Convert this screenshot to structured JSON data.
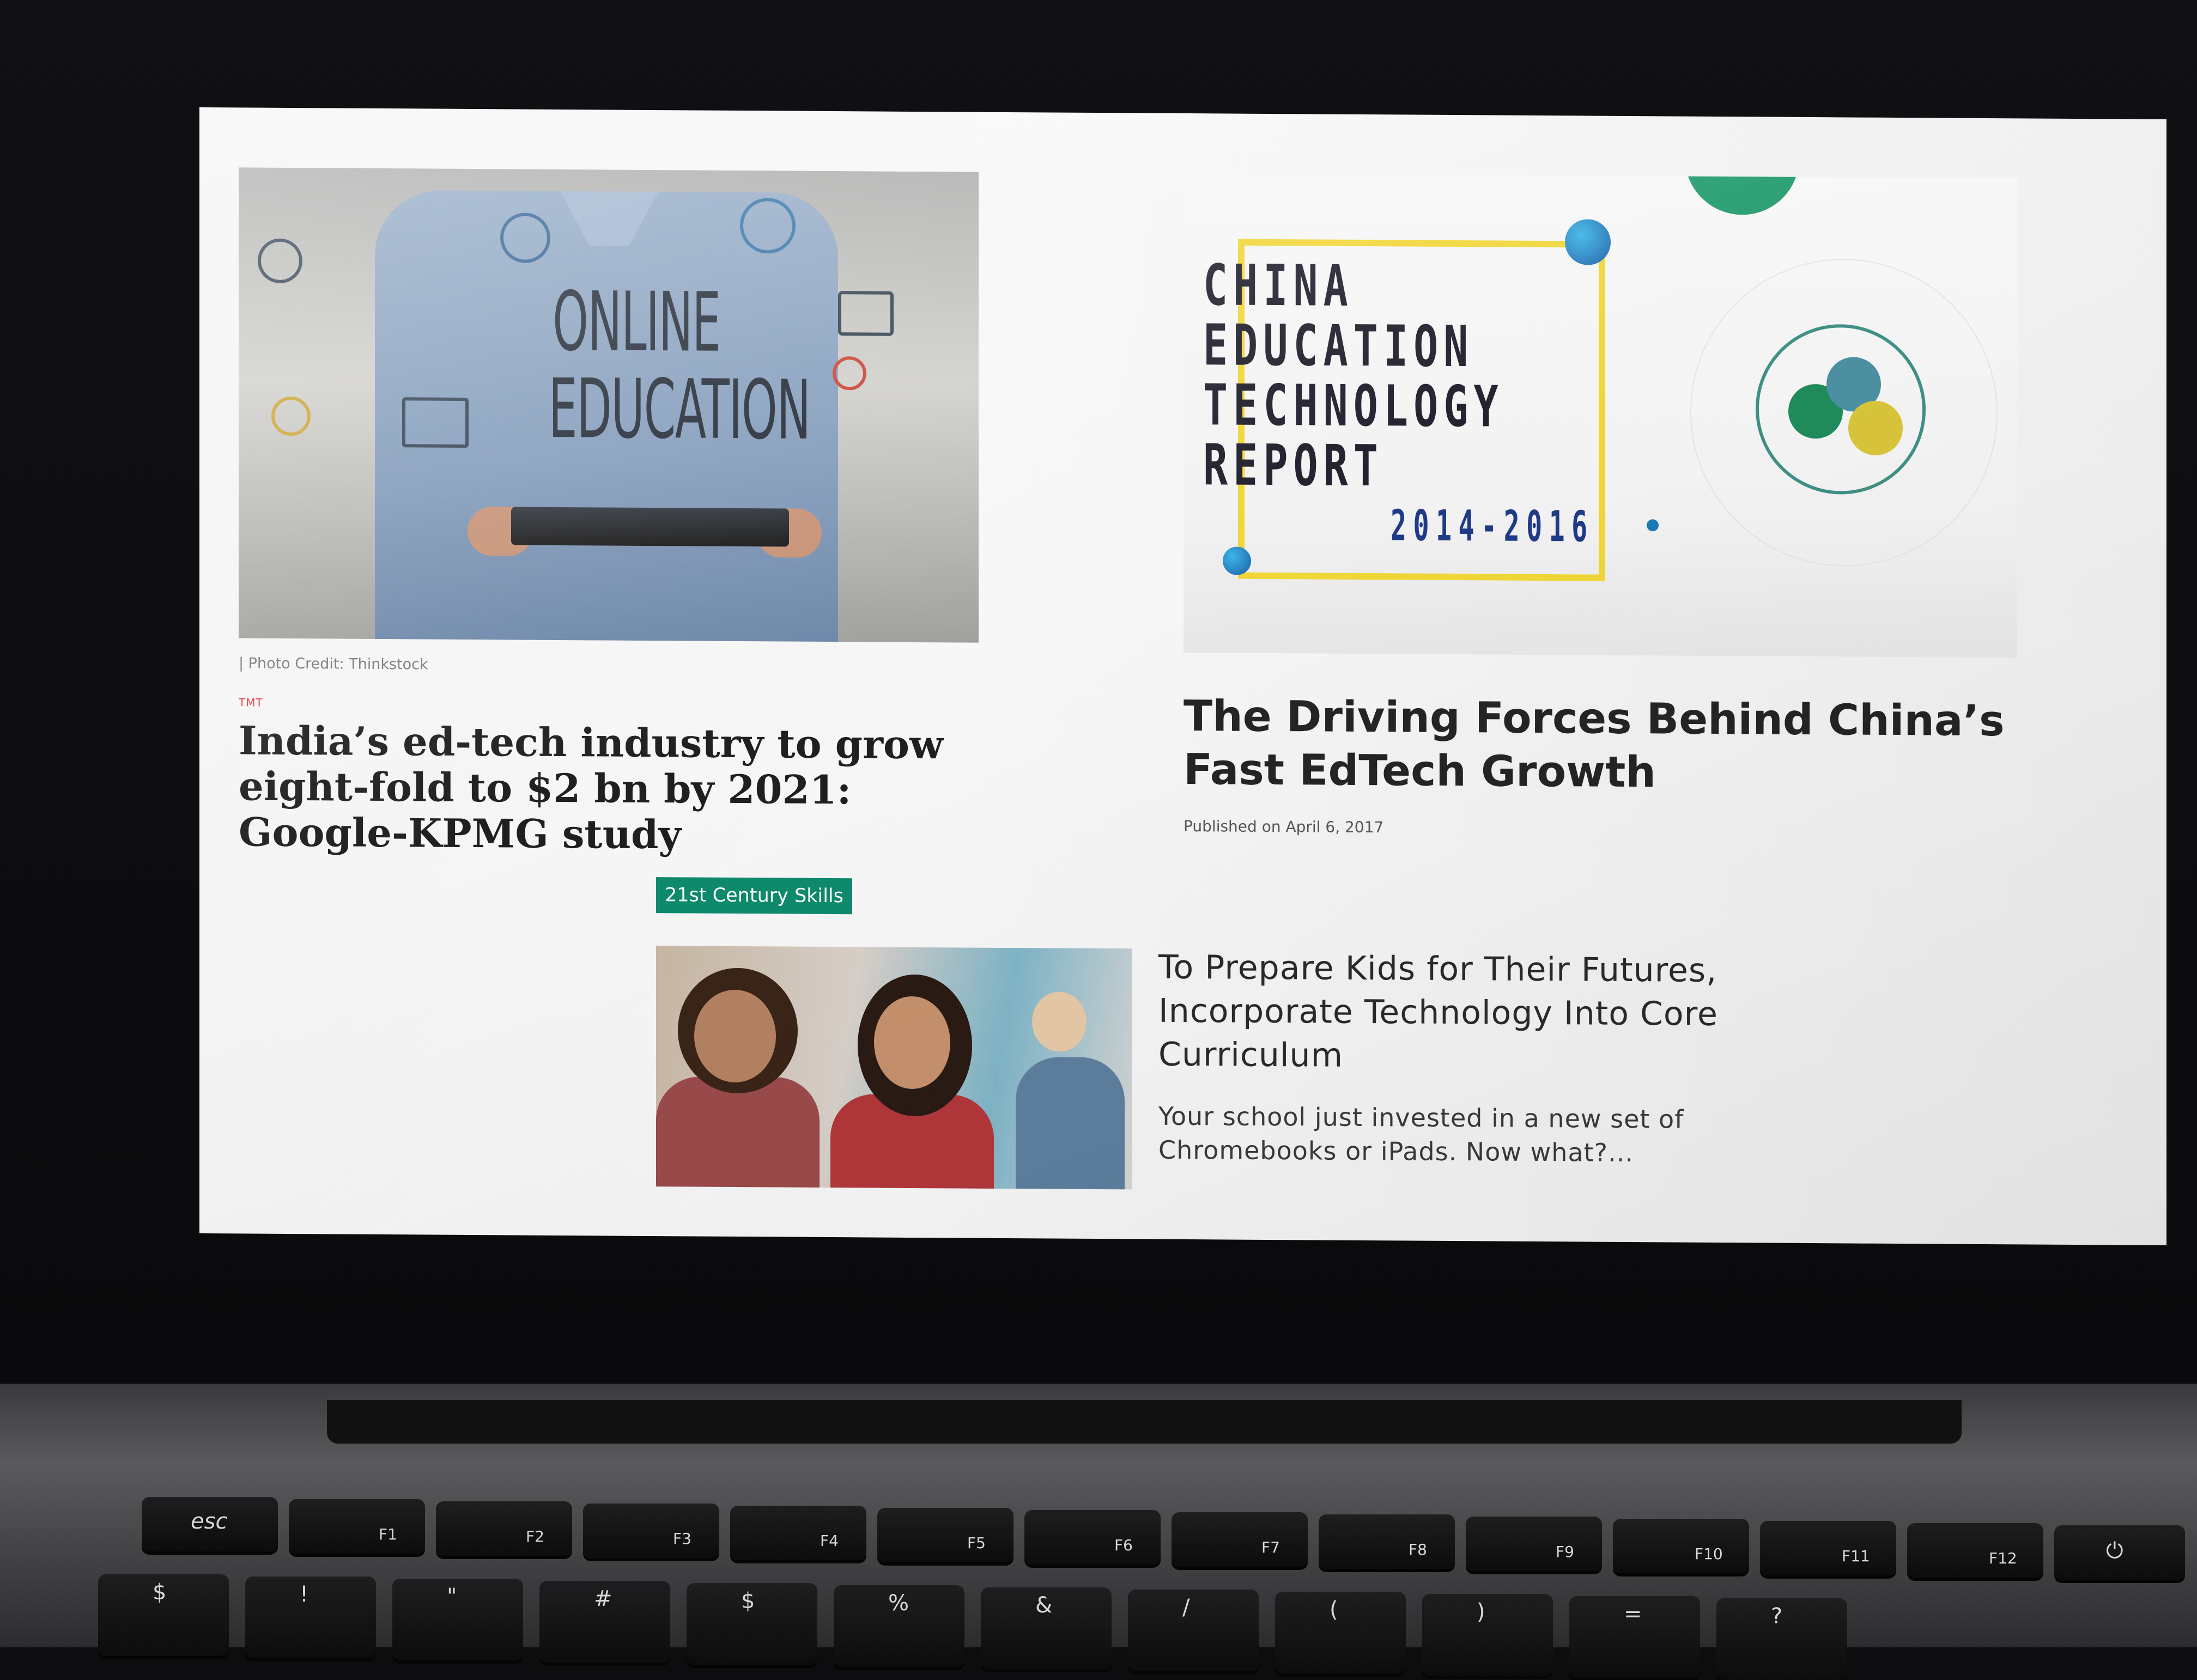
{
  "left_article": {
    "image_text_line1": "ONLINE",
    "image_text_line2": "EDUCATION",
    "photo_credit": "|  Photo Credit: Thinkstock",
    "category_tag": "TMT",
    "headline": "India’s ed-tech industry to grow eight-fold to $2 bn by 2021: Google-KPMG study"
  },
  "right_article": {
    "report_title_lines": [
      "CHINA",
      "EDUCATION",
      "TECHNOLOGY",
      "REPORT"
    ],
    "report_years": "2014-2016",
    "headline": "The Driving Forces Behind China’s Fast EdTech Growth",
    "published": "Published on April 6, 2017"
  },
  "bottom_article": {
    "category_badge": "21st Century Skills",
    "headline": "To Prepare Kids for Their Futures, Incorporate Technology Into Core Curriculum",
    "excerpt": "Your school just invested in a new set of Chromebooks or iPads. Now what?..."
  },
  "keyboard": {
    "function_row": [
      "esc",
      "F1",
      "F2",
      "F3",
      "F4",
      "F5",
      "F6",
      "F7",
      "F8",
      "F9",
      "F10",
      "F11",
      "F12"
    ],
    "number_row_symbols": [
      "$",
      "!",
      "\"",
      "#",
      "$",
      "%",
      "&",
      "/",
      "(",
      ")",
      "=",
      "?"
    ]
  },
  "colors": {
    "badge_green": "#0e8a6c",
    "tag_red": "#e0383e",
    "report_yellow": "#f0d636",
    "report_blue": "#1f3a86"
  }
}
